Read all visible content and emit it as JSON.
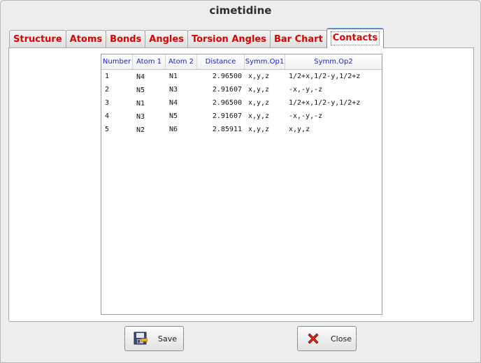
{
  "window": {
    "title": "cimetidine"
  },
  "tabs": [
    {
      "label": "Structure",
      "active": false
    },
    {
      "label": "Atoms",
      "active": false
    },
    {
      "label": "Bonds",
      "active": false
    },
    {
      "label": "Angles",
      "active": false
    },
    {
      "label": "Torsion Angles",
      "active": false
    },
    {
      "label": "Bar Chart",
      "active": false
    },
    {
      "label": "Contacts",
      "active": true
    }
  ],
  "table": {
    "columns": [
      "Number",
      "Atom 1",
      "Atom 2",
      "Distance",
      "Symm.Op1",
      "Symm.Op2"
    ],
    "swatch_color": "#00e5e5",
    "rows": [
      {
        "number": "1",
        "atom1": "N4",
        "atom2": "N1",
        "distance": "2.96500",
        "symm_op1": "x,y,z",
        "symm_op2": "1/2+x,1/2-y,1/2+z"
      },
      {
        "number": "2",
        "atom1": "N5",
        "atom2": "N3",
        "distance": "2.91607",
        "symm_op1": "x,y,z",
        "symm_op2": "-x,-y,-z"
      },
      {
        "number": "3",
        "atom1": "N1",
        "atom2": "N4",
        "distance": "2.96500",
        "symm_op1": "x,y,z",
        "symm_op2": "1/2+x,1/2-y,1/2+z"
      },
      {
        "number": "4",
        "atom1": "N3",
        "atom2": "N5",
        "distance": "2.91607",
        "symm_op1": "x,y,z",
        "symm_op2": "-x,-y,-z"
      },
      {
        "number": "5",
        "atom1": "N2",
        "atom2": "N6",
        "distance": "2.85911",
        "symm_op1": "x,y,z",
        "symm_op2": "x,y,z"
      }
    ]
  },
  "buttons": {
    "save": {
      "label": "Save",
      "icon": "save-icon"
    },
    "close": {
      "label": "Close",
      "icon": "close-icon"
    }
  },
  "colors": {
    "tab_text": "#e00000",
    "header_text": "#1d1dbb",
    "active_tab_top": "#5a8fd6"
  }
}
